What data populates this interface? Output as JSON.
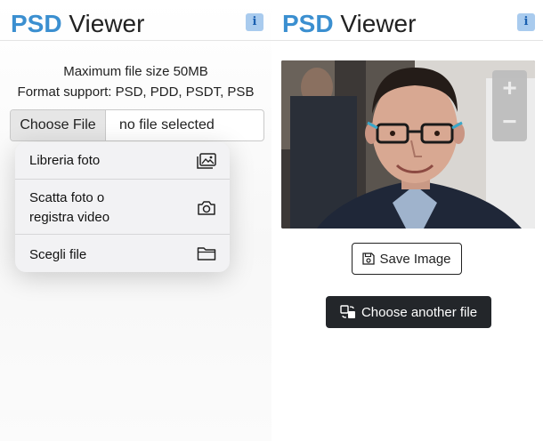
{
  "left": {
    "brand": {
      "psd": "PSD",
      "viewer": "Viewer"
    },
    "info_label": "i",
    "max_size": "Maximum file size 50MB",
    "formats": "Format support: PSD, PDD, PSDT, PSB",
    "file_input": {
      "button_label": "Choose File",
      "status": "no file selected"
    },
    "menu": [
      {
        "label": "Libreria foto",
        "icon": "photo-library-icon"
      },
      {
        "label_line1": "Scatta foto o",
        "label_line2": "registra video",
        "icon": "camera-icon"
      },
      {
        "label": "Scegli file",
        "icon": "folder-icon"
      }
    ]
  },
  "right": {
    "brand": {
      "psd": "PSD",
      "viewer": "Viewer"
    },
    "info_label": "i",
    "zoom": {
      "in": "+",
      "out": "−"
    },
    "save_label": "Save Image",
    "another_label": "Choose another file"
  },
  "colors": {
    "brand_blue": "#3b8fd0",
    "info_bg": "#a9cbee",
    "dark_button": "#23262a",
    "zoom_bg": "#bdbdbd"
  }
}
